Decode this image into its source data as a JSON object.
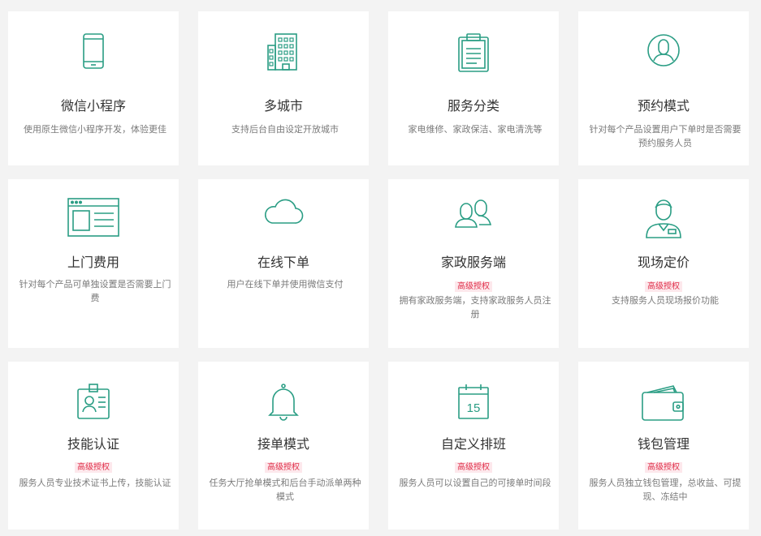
{
  "colors": {
    "accent": "#2a9d84",
    "badge_text": "#e0314b",
    "badge_bg": "#fde8ec",
    "background": "#f3f3f3"
  },
  "features": [
    {
      "title": "微信小程序",
      "badge": "",
      "desc": "使用原生微信小程序开发，体验更佳",
      "icon": "mobile-phone-icon"
    },
    {
      "title": "多城市",
      "badge": "",
      "desc": "支持后台自由设定开放城市",
      "icon": "city-buildings-icon"
    },
    {
      "title": "服务分类",
      "badge": "",
      "desc": "家电维修、家政保洁、家电清洗等",
      "icon": "clipboard-icon"
    },
    {
      "title": "预约模式",
      "badge": "",
      "desc": "针对每个产品设置用户下单时是否需要预约服务人员",
      "icon": "user-circle-icon"
    },
    {
      "title": "上门费用",
      "badge": "",
      "desc": "针对每个产品可单独设置是否需要上门费",
      "icon": "browser-window-icon"
    },
    {
      "title": "在线下单",
      "badge": "",
      "desc": "用户在线下单并使用微信支付",
      "icon": "cloud-icon"
    },
    {
      "title": "家政服务端",
      "badge": "高级授权",
      "desc": "拥有家政服务端，支持家政服务人员注册",
      "icon": "users-icon"
    },
    {
      "title": "现场定价",
      "badge": "高级授权",
      "desc": "支持服务人员现场报价功能",
      "icon": "service-staff-icon"
    },
    {
      "title": "技能认证",
      "badge": "高级授权",
      "desc": "服务人员专业技术证书上传，技能认证",
      "icon": "id-badge-icon"
    },
    {
      "title": "接单模式",
      "badge": "高级授权",
      "desc": "任务大厅抢单模式和后台手动派单两种模式",
      "icon": "bell-icon"
    },
    {
      "title": "自定义排班",
      "badge": "高级授权",
      "desc": "服务人员可以设置自己的可接单时间段",
      "icon": "calendar-icon"
    },
    {
      "title": "钱包管理",
      "badge": "高级授权",
      "desc": "服务人员独立钱包管理，总收益、可提现、冻结中",
      "icon": "wallet-icon"
    }
  ],
  "calendar_day": "15"
}
